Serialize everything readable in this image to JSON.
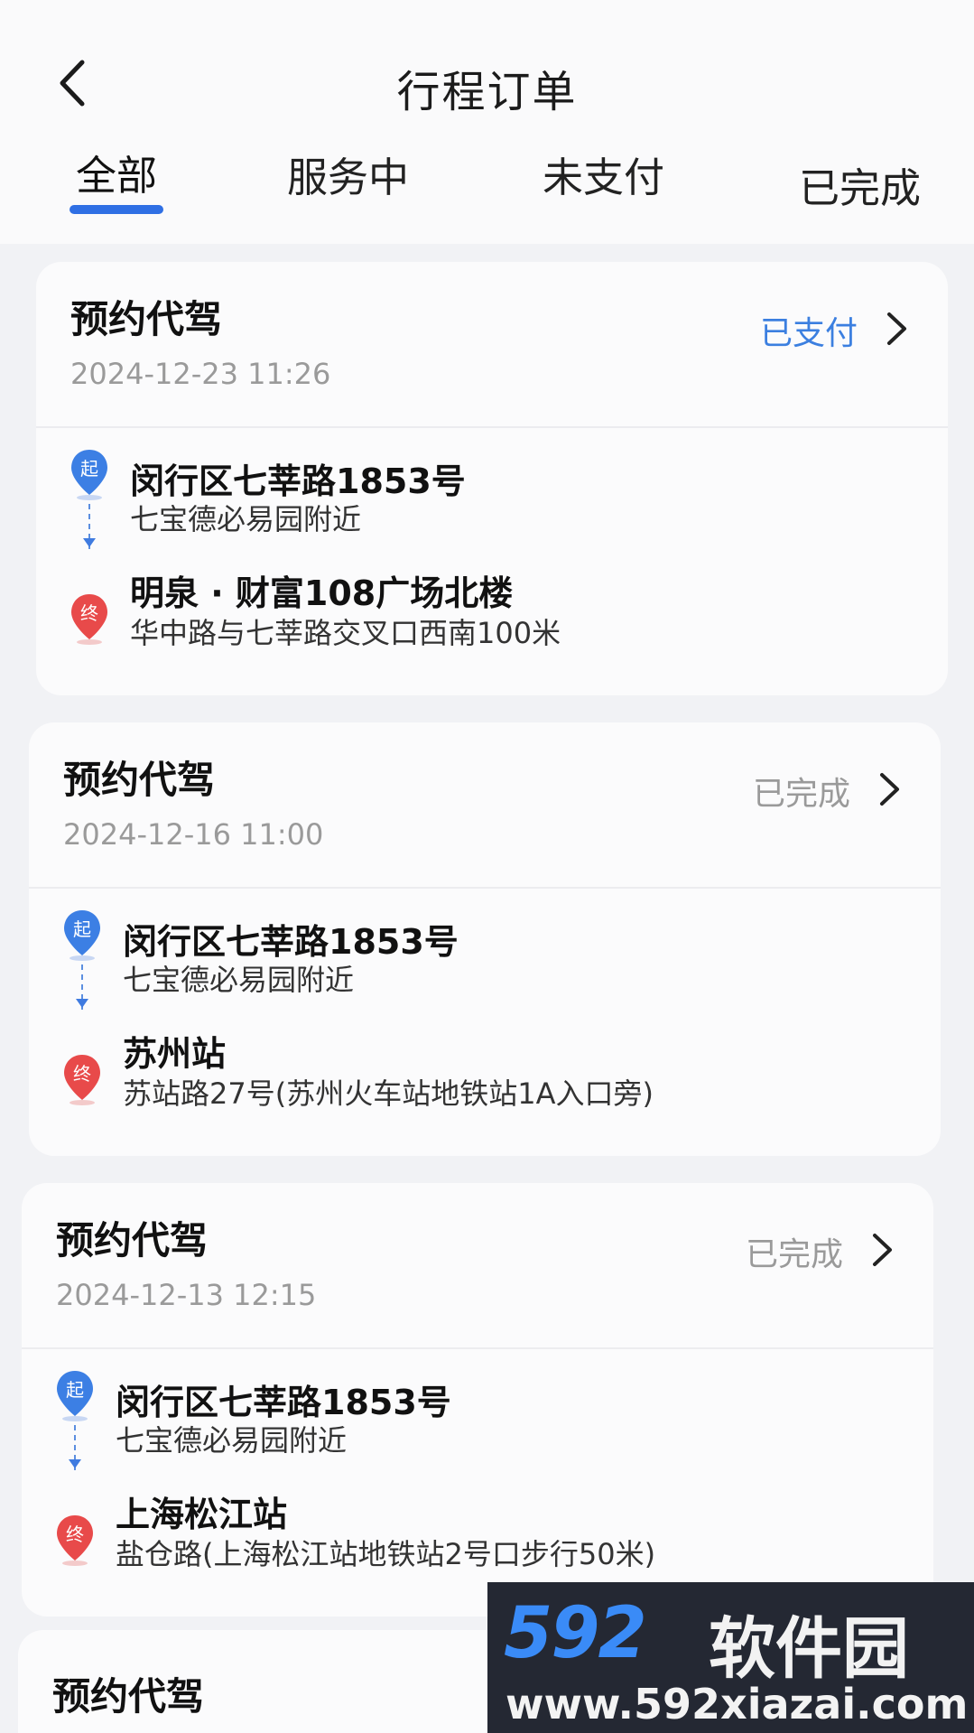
{
  "header": {
    "title": "行程订单",
    "tabs": [
      "全部",
      "服务中",
      "未支付",
      "已完成"
    ],
    "active_tab_index": 0
  },
  "orders": [
    {
      "type": "预约代驾",
      "time": "2024-12-23 11:26",
      "status": "已支付",
      "status_color": "#3b7fe0",
      "start_badge": "起",
      "start_name": "闵行区七莘路1853号",
      "start_detail": "七宝德必易园附近",
      "end_badge": "终",
      "end_name": "明泉 · 财富108广场北楼",
      "end_detail": "华中路与七莘路交叉口西南100米"
    },
    {
      "type": "预约代驾",
      "time": "2024-12-16 11:00",
      "status": "已完成",
      "status_color": "#9a9a9a",
      "start_badge": "起",
      "start_name": "闵行区七莘路1853号",
      "start_detail": "七宝德必易园附近",
      "end_badge": "终",
      "end_name": "苏州站",
      "end_detail": "苏站路27号(苏州火车站地铁站1A入口旁)"
    },
    {
      "type": "预约代驾",
      "time": "2024-12-13 12:15",
      "status": "已完成",
      "status_color": "#9a9a9a",
      "start_badge": "起",
      "start_name": "闵行区七莘路1853号",
      "start_detail": "七宝德必易园附近",
      "end_badge": "终",
      "end_name": "上海松江站",
      "end_detail": "盐仓路(上海松江站地铁站2号口步行50米)"
    },
    {
      "type": "预约代驾"
    }
  ],
  "watermark": {
    "logo_number": "592",
    "logo_text": "软件园",
    "url": "www.592xiazai.com"
  },
  "colors": {
    "accent": "#2f6fe4",
    "start_pin": "#3c7fe4",
    "end_pin": "#e84a4a"
  }
}
